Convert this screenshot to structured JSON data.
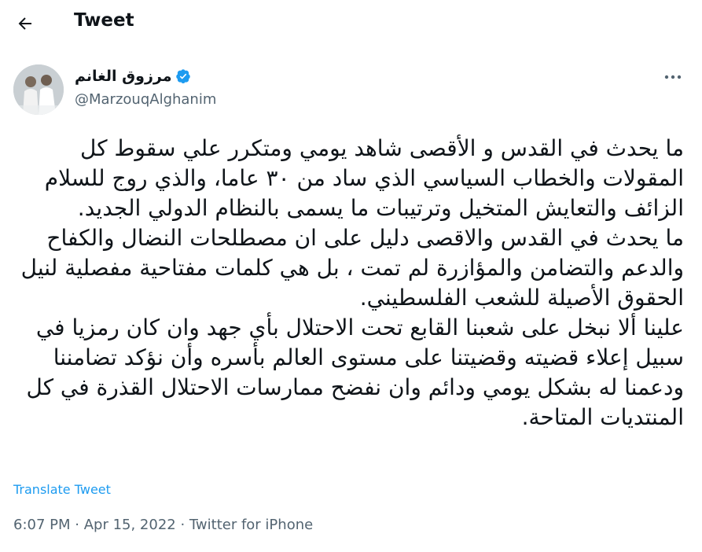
{
  "header": {
    "title": "Tweet"
  },
  "author": {
    "name": "مرزوق الغانم",
    "handle": "@MarzouqAlghanim",
    "verified": true
  },
  "tweet": {
    "paragraphs": [
      "ما يحدث في القدس و الأقصى شاهد يومي ومتكرر علي سقوط كل المقولات والخطاب السياسي الذي ساد من ٣٠ عاما، والذي روج للسلام الزائف والتعايش المتخيل وترتيبات ما يسمى بالنظام الدولي الجديد.",
      "ما يحدث في القدس والاقصى دليل على ان مصطلحات النضال والكفاح والدعم والتضامن والمؤازرة لم تمت ، بل هي كلمات مفتاحية مفصلية لنيل الحقوق الأصيلة للشعب الفلسطيني.",
      "علينا ألا نبخل على شعبنا القابع تحت الاحتلال بأي جهد وان كان رمزيا في سبيل إعلاء قضيته وقضيتنا على مستوى العالم بأسره وأن نؤكد تضامننا ودعمنا له بشكل يومي ودائم وان نفضح ممارسات الاحتلال القذرة في كل المنتديات المتاحة."
    ],
    "translate_label": "Translate Tweet",
    "time": "6:07 PM",
    "separator": " · ",
    "date": "Apr 15, 2022",
    "source": "Twitter for iPhone"
  },
  "icons": {
    "back": "arrow-left-icon",
    "verified": "verified-badge-icon",
    "more": "more-horizontal-icon"
  },
  "colors": {
    "accent": "#1d9bf0",
    "secondary_text": "#536471",
    "primary_text": "#0f1419"
  }
}
